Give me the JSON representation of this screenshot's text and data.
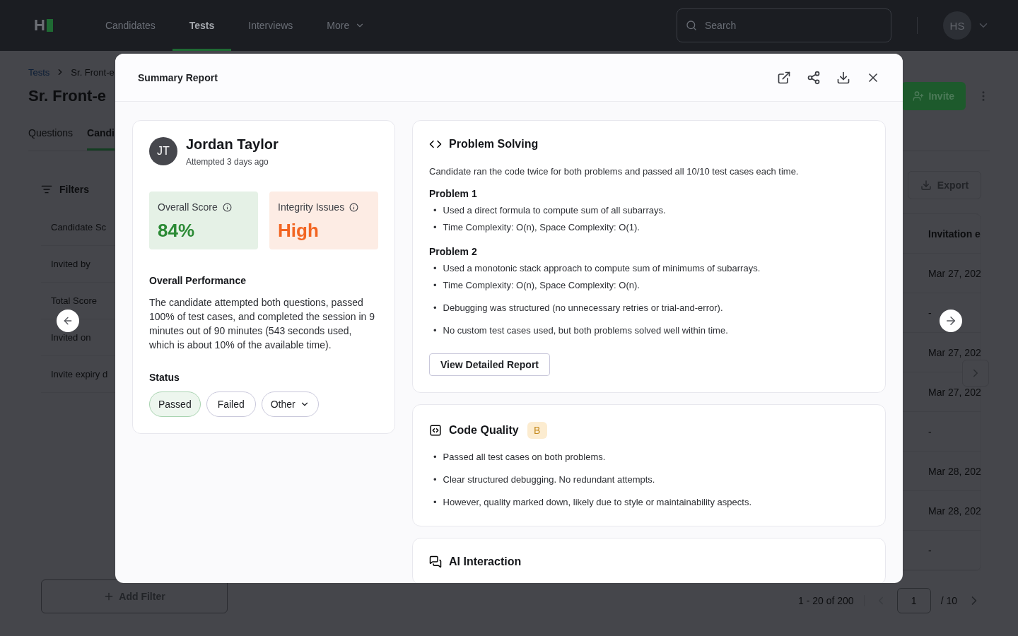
{
  "nav": {
    "logo": "H",
    "items": [
      {
        "label": "Candidates",
        "selected": false
      },
      {
        "label": "Tests",
        "selected": true
      },
      {
        "label": "Interviews",
        "selected": false
      },
      {
        "label": "More",
        "selected": false,
        "kind": "menu"
      }
    ],
    "search": {
      "placeholder": "Search"
    },
    "avatar": "HS"
  },
  "breadcrumb": [
    "Tests",
    "Sr. Front-e"
  ],
  "page_title": "Sr. Front-e",
  "invite_button": "Invite",
  "page_tabs": [
    {
      "label": "Questions",
      "selected": false
    },
    {
      "label": "Candi",
      "selected": true
    }
  ],
  "filters": {
    "title": "Filters",
    "items": [
      "Candidate Sc",
      "Invited by",
      "Total Score",
      "Invited on",
      "Invite expiry d"
    ],
    "add_button": "Add Filter"
  },
  "export_button": "Export",
  "table": {
    "columns": [
      "Invitation e"
    ],
    "rows": [
      [
        "Mar 27, 202"
      ],
      [
        "-"
      ],
      [
        "Mar 27, 202"
      ],
      [
        "Mar 27, 202"
      ],
      [
        "-"
      ],
      [
        "Mar 28, 202"
      ],
      [
        "Mar 28, 202"
      ],
      [
        "-"
      ]
    ]
  },
  "pagination": {
    "range": "1 - 20 of 200",
    "page": "1",
    "total": "/ 10"
  },
  "modal": {
    "title": "Summary Report",
    "candidate": {
      "initials": "JT",
      "name": "Jordan Taylor",
      "attempted": "Attempted 3 days ago"
    },
    "metrics": [
      {
        "label": "Overall Score",
        "value": "84%",
        "color": "#2b8a35"
      },
      {
        "label": "Integrity Issues",
        "value": "High",
        "color": "#f26522"
      }
    ],
    "bullet_marker": "•",
    "performance": {
      "title": "Overall Performance",
      "text": "The candidate attempted both questions, passed 100% of test cases, and completed the session in 9 minutes out of 90 minutes (543 seconds used, which is about 10% of the available time)."
    },
    "status": {
      "title": "Status",
      "options": [
        {
          "label": "Passed",
          "selected": true
        },
        {
          "label": "Failed",
          "selected": false
        },
        {
          "label": "Other",
          "selected": false,
          "kind": "dropdown"
        }
      ]
    },
    "sections": [
      {
        "kind": "problem_solving",
        "title": "Problem Solving",
        "summary": "Candidate ran the code twice for both problems and passed all 10/10 test cases each time.",
        "problems": [
          {
            "title": "Problem 1",
            "bullets": [
              "Used a direct formula to compute sum of all subarrays.",
              "Time Complexity: O(n), Space Complexity: O(1)."
            ]
          },
          {
            "title": "Problem 2",
            "bullets": [
              "Used a monotonic stack approach to compute sum of minimums of subarrays.",
              "Time Complexity: O(n), Space Complexity: O(n)."
            ]
          }
        ],
        "notes": [
          "Debugging was structured (no unnecessary retries or trial-and-error).",
          "No custom test cases used, but both problems solved well within time."
        ],
        "button": "View Detailed Report"
      },
      {
        "kind": "code_quality",
        "title": "Code Quality",
        "grade": "B",
        "notes": [
          "Passed all test cases on both problems.",
          "Clear structured debugging. No redundant attempts.",
          "However, quality marked down, likely due to style or maintainability aspects."
        ]
      },
      {
        "kind": "ai_interaction",
        "title": "AI Interaction"
      }
    ]
  }
}
